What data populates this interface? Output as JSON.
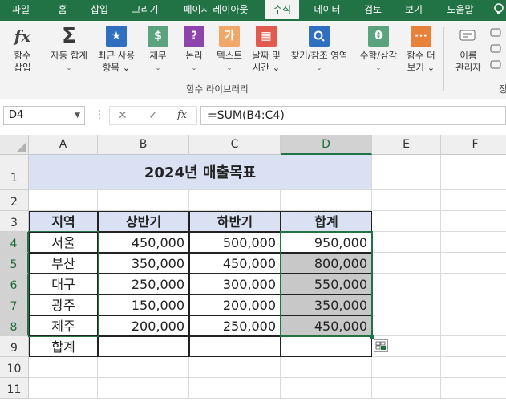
{
  "tabs": [
    "파일",
    "홈",
    "삽입",
    "그리기",
    "페이지 레이아웃",
    "수식",
    "데이터",
    "검토",
    "보기",
    "도움말"
  ],
  "active_tab": "수식",
  "ribbon": {
    "buttons": [
      {
        "label1": "함수",
        "label2": "삽입",
        "icon": "fx-icon",
        "glyph": "fx"
      },
      {
        "label1": "자동 합계",
        "label2": "⌄",
        "icon": "sigma-icon",
        "glyph": "Σ"
      },
      {
        "label1": "최근 사용",
        "label2": "항목 ⌄",
        "icon": "star-icon",
        "glyph": "★"
      },
      {
        "label1": "재무",
        "label2": "⌄",
        "icon": "finance-icon",
        "glyph": "$"
      },
      {
        "label1": "논리",
        "label2": "⌄",
        "icon": "logic-icon",
        "glyph": "?"
      },
      {
        "label1": "텍스트",
        "label2": "⌄",
        "icon": "text-icon",
        "glyph": "가"
      },
      {
        "label1": "날짜 및",
        "label2": "시간 ⌄",
        "icon": "calendar-icon",
        "glyph": "▦"
      },
      {
        "label1": "찾기/참조 영역",
        "label2": "⌄",
        "icon": "lookup-icon",
        "glyph": "🔍"
      },
      {
        "label1": "수학/삼각",
        "label2": "⌄",
        "icon": "math-icon",
        "glyph": "θ"
      },
      {
        "label1": "함수 더",
        "label2": "보기 ⌄",
        "icon": "more-functions-icon",
        "glyph": "···"
      },
      {
        "label1": "이름",
        "label2": "관리자",
        "icon": "name-manager-icon",
        "glyph": ""
      }
    ],
    "group_label": "함수 라이브러리",
    "partial_label": "정"
  },
  "formula_bar": {
    "name_box": "D4",
    "cancel": "✕",
    "enter": "✓",
    "fx": "fx",
    "formula": "=SUM(B4:C4)"
  },
  "columns": [
    "A",
    "B",
    "C",
    "D",
    "E",
    "F"
  ],
  "selected_column": "D",
  "rows": [
    "1",
    "2",
    "3",
    "4",
    "5",
    "6",
    "7",
    "8",
    "9",
    "10",
    "11"
  ],
  "selected_rows": [
    "4",
    "5",
    "6",
    "7",
    "8"
  ],
  "sheet": {
    "title": "2024년 매출목표",
    "headers": [
      "지역",
      "상반기",
      "하반기",
      "합계"
    ],
    "data": [
      {
        "region": "서울",
        "h1": "450,000",
        "h2": "500,000",
        "total": "950,000"
      },
      {
        "region": "부산",
        "h1": "350,000",
        "h2": "450,000",
        "total": "800,000"
      },
      {
        "region": "대구",
        "h1": "250,000",
        "h2": "300,000",
        "total": "550,000"
      },
      {
        "region": "광주",
        "h1": "150,000",
        "h2": "200,000",
        "total": "350,000"
      },
      {
        "region": "제주",
        "h1": "200,000",
        "h2": "250,000",
        "total": "450,000"
      }
    ],
    "total_label": "합계"
  },
  "colors": {
    "accent": "#217346",
    "header_fill": "#d9e1f2",
    "shaded": "#c8c8c8"
  }
}
